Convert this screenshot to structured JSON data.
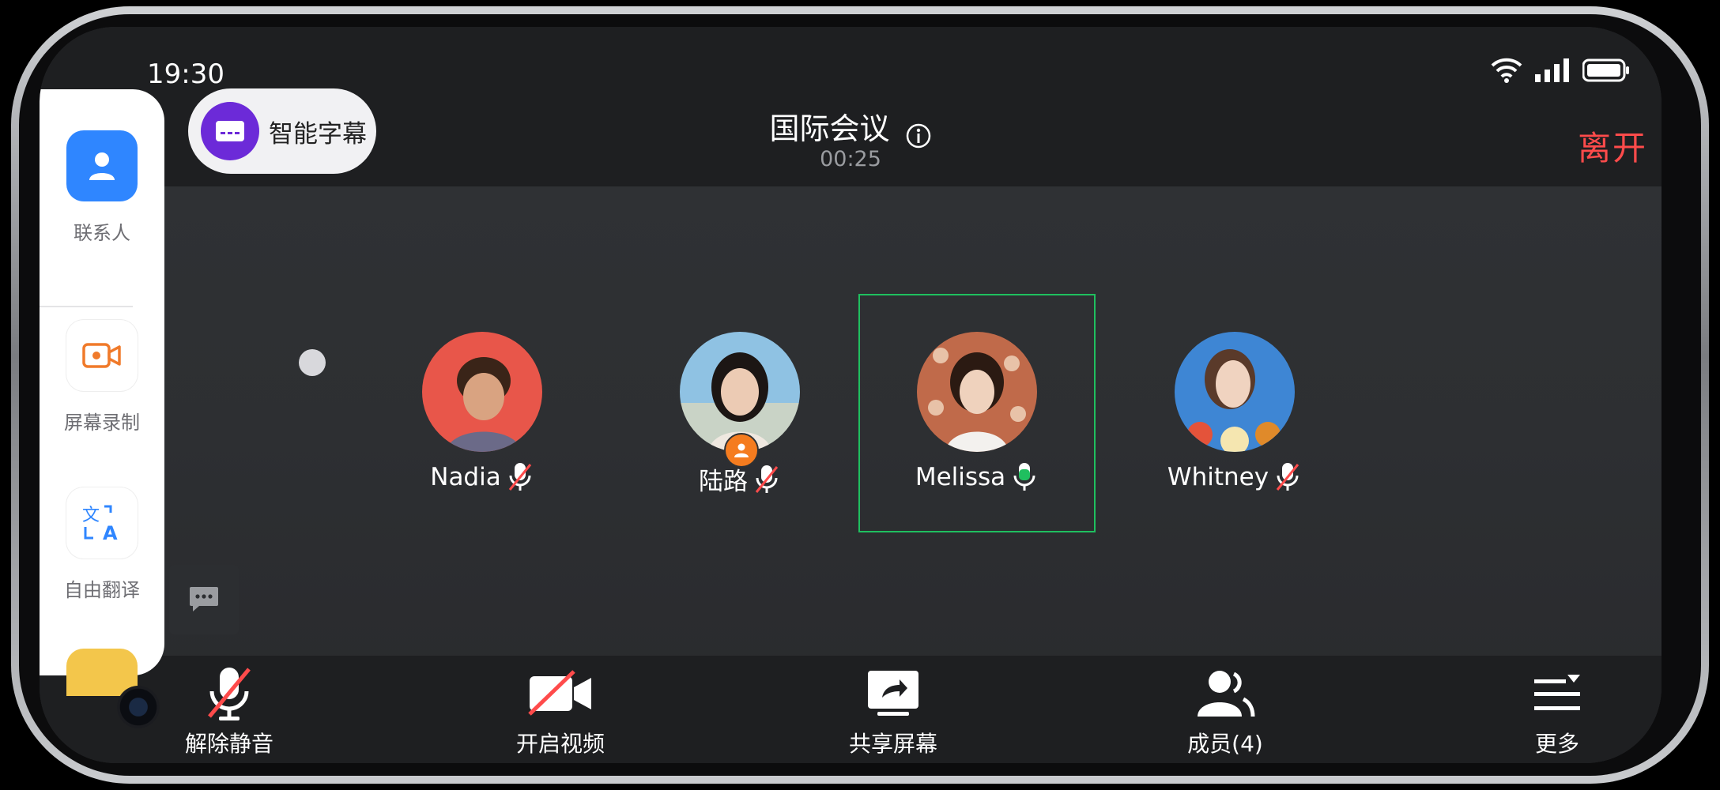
{
  "status": {
    "time": "19:30",
    "icons": [
      "wifi-icon",
      "signal-icon",
      "battery-icon"
    ]
  },
  "header": {
    "subtitle_button_label": "智能字幕",
    "title": "国际会议",
    "timer": "00:25",
    "leave_label": "离开"
  },
  "dock": {
    "items": [
      {
        "label": "联系人",
        "icon": "contacts-icon"
      },
      {
        "label": "屏幕录制",
        "icon": "screen-record-icon"
      },
      {
        "label": "自由翻译",
        "icon": "translate-icon"
      }
    ]
  },
  "participants": [
    {
      "name": "Nadia",
      "mic": "muted"
    },
    {
      "name": "陆路",
      "mic": "muted",
      "role": "host"
    },
    {
      "name": "Melissa",
      "mic": "speaking"
    },
    {
      "name": "Whitney",
      "mic": "muted"
    }
  ],
  "controls": [
    {
      "label": "解除静音",
      "icon": "mic-muted-icon"
    },
    {
      "label": "开启视频",
      "icon": "video-off-icon"
    },
    {
      "label": "共享屏幕",
      "icon": "share-screen-icon"
    },
    {
      "label": "成员(4)",
      "icon": "members-icon"
    },
    {
      "label": "更多",
      "icon": "more-menu-icon"
    }
  ],
  "colors": {
    "accent_purple": "#6c2ad8",
    "leave_red": "#ff4b4b",
    "speaking_green": "#1fbf5f",
    "host_orange": "#f57c1f",
    "mute_red": "#ff4b4b"
  }
}
